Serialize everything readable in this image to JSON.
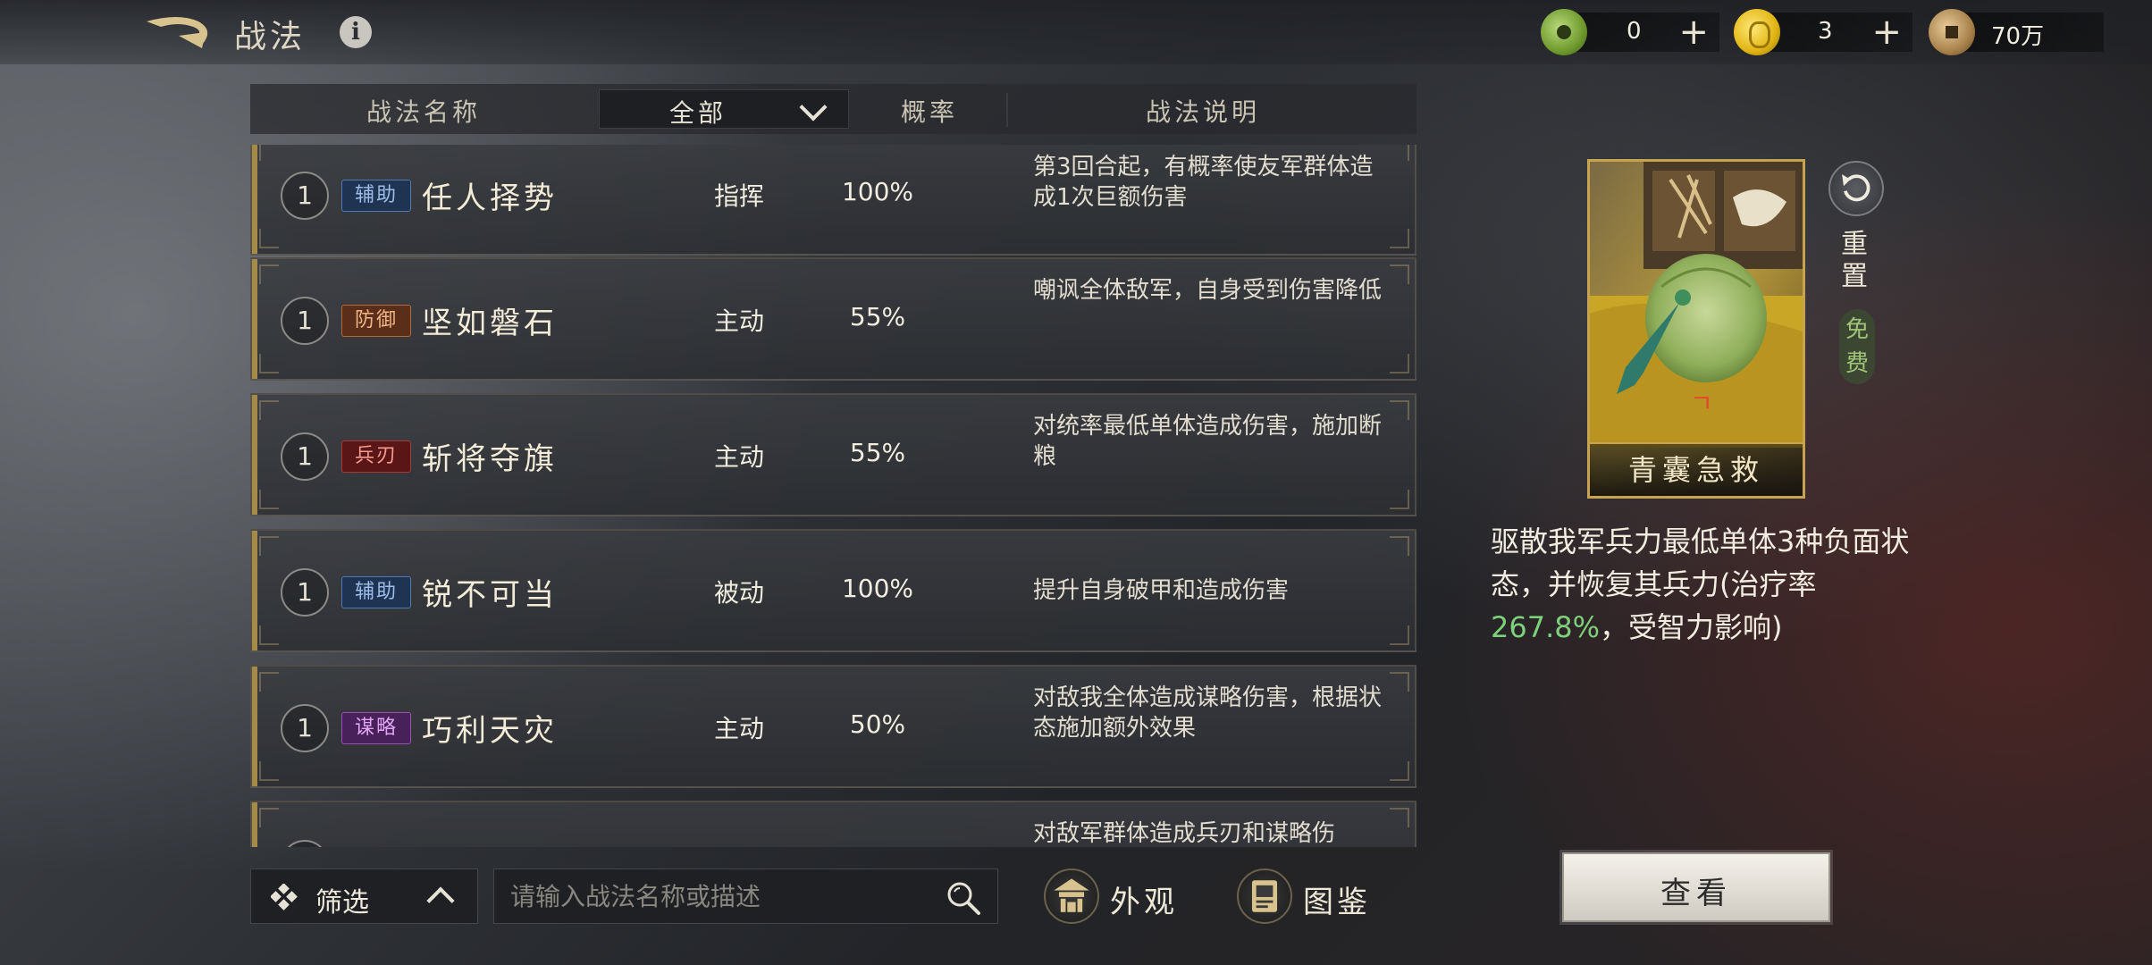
{
  "header": {
    "title": "战法",
    "info_glyph": "i"
  },
  "currencies": [
    {
      "name": "jade-coin",
      "value": "0"
    },
    {
      "name": "gold-ingot",
      "value": "3"
    },
    {
      "name": "copper-coin",
      "value": "70万"
    }
  ],
  "table": {
    "col_name": "战法名称",
    "type_filter": "全部",
    "col_rate": "概率",
    "col_desc": "战法说明"
  },
  "skills": [
    {
      "level": "1",
      "tag": "辅助",
      "tag_kind": "assist",
      "name": "任人择势",
      "type": "指挥",
      "rate": "100%",
      "desc": "第3回合起，有概率使友军群体造成1次巨额伤害"
    },
    {
      "level": "1",
      "tag": "防御",
      "tag_kind": "defend",
      "name": "坚如磐石",
      "type": "主动",
      "rate": "55%",
      "desc": "嘲讽全体敌军，自身受到伤害降低"
    },
    {
      "level": "1",
      "tag": "兵刃",
      "tag_kind": "weapon",
      "name": "斩将夺旗",
      "type": "主动",
      "rate": "55%",
      "desc": "对统率最低单体造成伤害，施加断粮"
    },
    {
      "level": "1",
      "tag": "辅助",
      "tag_kind": "assist",
      "name": "锐不可当",
      "type": "被动",
      "rate": "100%",
      "desc": "提升自身破甲和造成伤害"
    },
    {
      "level": "1",
      "tag": "谋略",
      "tag_kind": "strategy",
      "name": "巧利天灾",
      "type": "主动",
      "rate": "50%",
      "desc": "对敌我全体造成谋略伤害，根据状态施加额外效果"
    },
    {
      "level": "",
      "tag": "",
      "tag_kind": "extra",
      "name": "",
      "type": "",
      "rate": "",
      "desc": "对敌军群体造成兵刃和谋略伤"
    }
  ],
  "bottom": {
    "filter_label": "筛选",
    "search_placeholder": "请输入战法名称或描述",
    "appearance_label": "外观",
    "codex_label": "图鉴"
  },
  "detail": {
    "card_name": "青囊急救",
    "reset_label": "重置",
    "free_label": "免费",
    "desc_before": "驱散我军兵力最低单体3种负面状态，并恢复其兵力(治疗率",
    "desc_value": "267.8%",
    "desc_after": "，受智力影响)",
    "view_label": "查看"
  },
  "colors": {
    "accent_gold": "#c7a24f",
    "highlight_green": "#7ed07a"
  }
}
